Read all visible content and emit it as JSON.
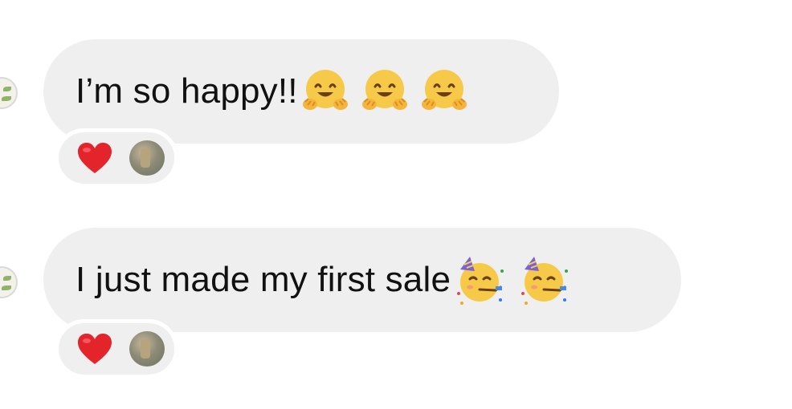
{
  "messages": [
    {
      "text": "I’m so happy!!",
      "emojis": [
        "hugging-face",
        "hugging-face",
        "hugging-face"
      ],
      "reaction": {
        "emoji": "heart",
        "color": "#e3242b"
      }
    },
    {
      "text": "I just made my first sale",
      "emojis": [
        "partying-face",
        "partying-face"
      ],
      "reaction": {
        "emoji": "heart",
        "color": "#e3242b"
      }
    }
  ],
  "colors": {
    "bubble_bg": "#efefef",
    "text": "#111111",
    "heart": "#e3242b",
    "emoji_yellow": "#f7c948"
  }
}
